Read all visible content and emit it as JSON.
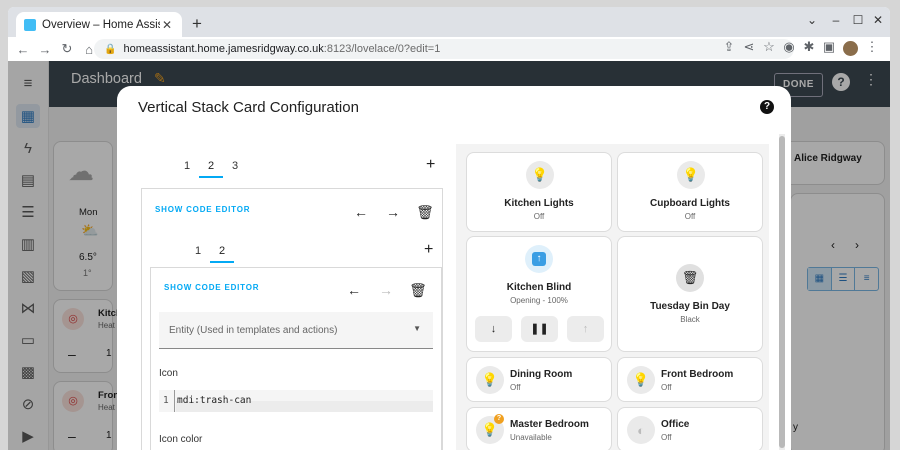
{
  "browser": {
    "tab_title": "Overview – Home Assista",
    "url_host": "homeassistant.home.jamesridgway.co.uk",
    "url_rest": ":8123/lovelace/0?edit=1"
  },
  "header": {
    "title": "Dashboard",
    "done_label": "DONE",
    "help_icon": "?"
  },
  "background": {
    "weather_day": "Mon",
    "weather_temp": "6.5°",
    "weather_low": "1°",
    "row1_name": "Kitch",
    "row1_sub": "Heat",
    "row1_value": "1",
    "row2_name": "Fron",
    "row2_sub": "Heat",
    "row2_value": "1",
    "person_name": "Alice Ridgway",
    "side_letter": "y"
  },
  "dialog": {
    "title": "Vertical Stack Card Configuration",
    "outer_tabs": [
      "1",
      "2",
      "3"
    ],
    "outer_selected": 1,
    "outer_code_link": "SHOW CODE EDITOR",
    "inner_tabs": [
      "1",
      "2"
    ],
    "inner_selected": 1,
    "inner_code_link": "SHOW CODE EDITOR",
    "entity_placeholder": "Entity (Used in templates and actions)",
    "icon_label": "Icon",
    "code_line_number": "1",
    "code_value": "mdi:trash-can",
    "icon_color_label": "Icon color"
  },
  "preview": {
    "tiles": [
      {
        "name": "Kitchen Lights",
        "state": "Off"
      },
      {
        "name": "Cupboard Lights",
        "state": "Off"
      },
      {
        "name": "Kitchen Blind",
        "state": "Opening - 100%"
      },
      {
        "name": "Tuesday Bin Day",
        "state": "Black"
      },
      {
        "name": "Dining Room",
        "state": "Off"
      },
      {
        "name": "Front Bedroom",
        "state": "Off"
      },
      {
        "name": "Master Bedroom",
        "state": "Unavailable",
        "badge": "?"
      },
      {
        "name": "Office",
        "state": "Off"
      }
    ]
  },
  "colors": {
    "accent": "#03a9f4",
    "header_bg": "#3d4a52",
    "warning": "#f0a020"
  }
}
